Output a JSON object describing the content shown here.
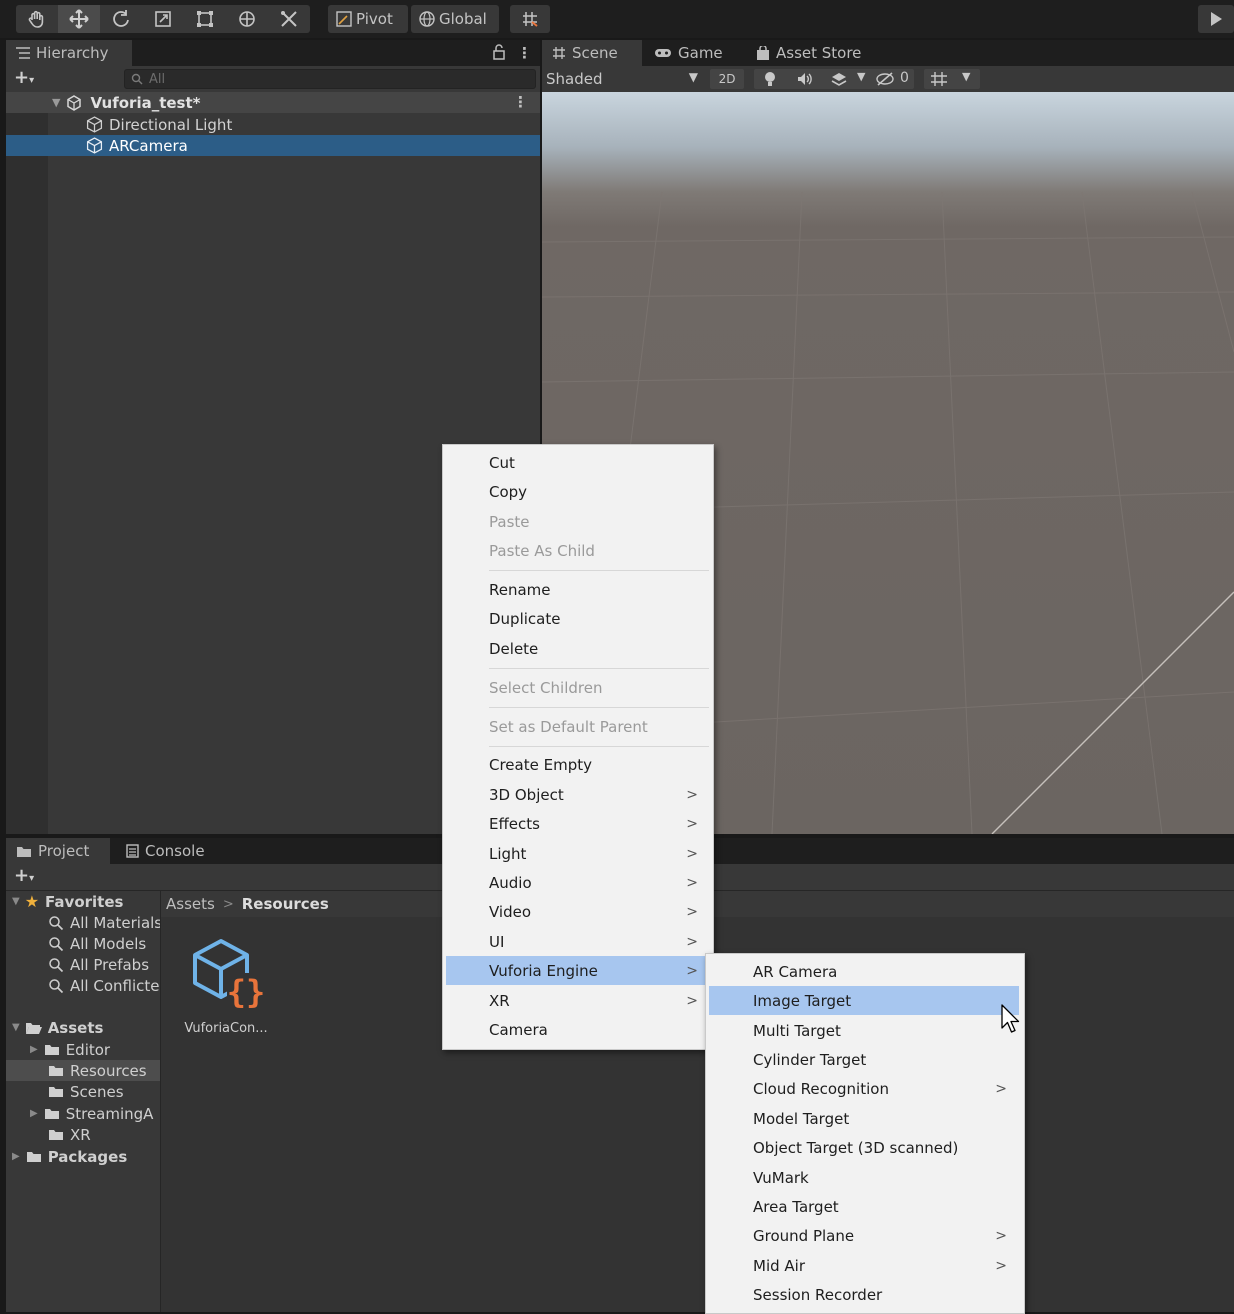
{
  "toolbar": {
    "tools": [
      {
        "name": "hand-tool",
        "icon": "hand-icon",
        "glyph": "✋"
      },
      {
        "name": "move-tool",
        "icon": "move-icon",
        "glyph": "✥"
      },
      {
        "name": "rotate-tool",
        "icon": "rotate-icon",
        "glyph": "⟲"
      },
      {
        "name": "scale-tool",
        "icon": "scale-icon",
        "glyph": "⤡"
      },
      {
        "name": "rect-tool",
        "icon": "rect-icon",
        "glyph": "⬚"
      },
      {
        "name": "transform-tool",
        "icon": "transform-icon",
        "glyph": "⊛"
      },
      {
        "name": "custom-tool",
        "icon": "custom-tool-icon",
        "glyph": "✕"
      }
    ],
    "pivot_label": "Pivot",
    "global_label": "Global",
    "snap_icon": "grid-snap-icon",
    "play_icon": "play-icon"
  },
  "hierarchy": {
    "tab_label": "Hierarchy",
    "search_placeholder": "All",
    "scene_name": "Vuforia_test*",
    "items": [
      "Directional Light",
      "ARCamera"
    ],
    "selected_item": "ARCamera"
  },
  "scene": {
    "tabs": [
      "Scene",
      "Game",
      "Asset Store"
    ],
    "active_tab": "Scene",
    "shading_mode": "Shaded",
    "mode_2d": "2D",
    "hidden_count": "0"
  },
  "project": {
    "tabs": [
      "Project",
      "Console"
    ],
    "active_tab": "Project",
    "favorites_label": "Favorites",
    "favorites": [
      "All Materials",
      "All Models",
      "All Prefabs",
      "All Conflicte"
    ],
    "assets_label": "Assets",
    "folders": [
      "Editor",
      "Resources",
      "Scenes",
      "StreamingA",
      "XR"
    ],
    "packages_label": "Packages",
    "selected_folder": "Resources",
    "breadcrumb": [
      "Assets",
      "Resources"
    ],
    "files": [
      {
        "name": "VuforiaCon...",
        "icon": "vuforia-config-icon"
      }
    ]
  },
  "context_menu": {
    "items": [
      {
        "label": "Cut"
      },
      {
        "label": "Copy"
      },
      {
        "label": "Paste",
        "disabled": true
      },
      {
        "label": "Paste As Child",
        "disabled": true
      },
      {
        "label": "Rename"
      },
      {
        "label": "Duplicate"
      },
      {
        "label": "Delete"
      },
      {
        "label": "Select Children",
        "disabled": true
      },
      {
        "label": "Set as Default Parent",
        "disabled": true
      },
      {
        "label": "Create Empty"
      },
      {
        "label": "3D Object",
        "submenu": true
      },
      {
        "label": "Effects",
        "submenu": true
      },
      {
        "label": "Light",
        "submenu": true
      },
      {
        "label": "Audio",
        "submenu": true
      },
      {
        "label": "Video",
        "submenu": true
      },
      {
        "label": "UI",
        "submenu": true
      },
      {
        "label": "Vuforia Engine",
        "submenu": true,
        "highlighted": true
      },
      {
        "label": "XR",
        "submenu": true
      },
      {
        "label": "Camera"
      }
    ]
  },
  "submenu": {
    "title": "Vuforia Engine",
    "items": [
      {
        "label": "AR Camera"
      },
      {
        "label": "Image Target",
        "highlighted": true
      },
      {
        "label": "Multi Target"
      },
      {
        "label": "Cylinder Target"
      },
      {
        "label": "Cloud Recognition",
        "submenu": true
      },
      {
        "label": "Model Target"
      },
      {
        "label": "Object Target (3D scanned)"
      },
      {
        "label": "VuMark"
      },
      {
        "label": "Area Target"
      },
      {
        "label": "Ground Plane",
        "submenu": true
      },
      {
        "label": "Mid Air",
        "submenu": true
      },
      {
        "label": "Session Recorder"
      }
    ]
  },
  "colors": {
    "menu_highlight": "#a7c6ef",
    "selection": "#2c5d87",
    "accent_orange": "#e8743b",
    "accent_blue": "#6fb3e8"
  }
}
